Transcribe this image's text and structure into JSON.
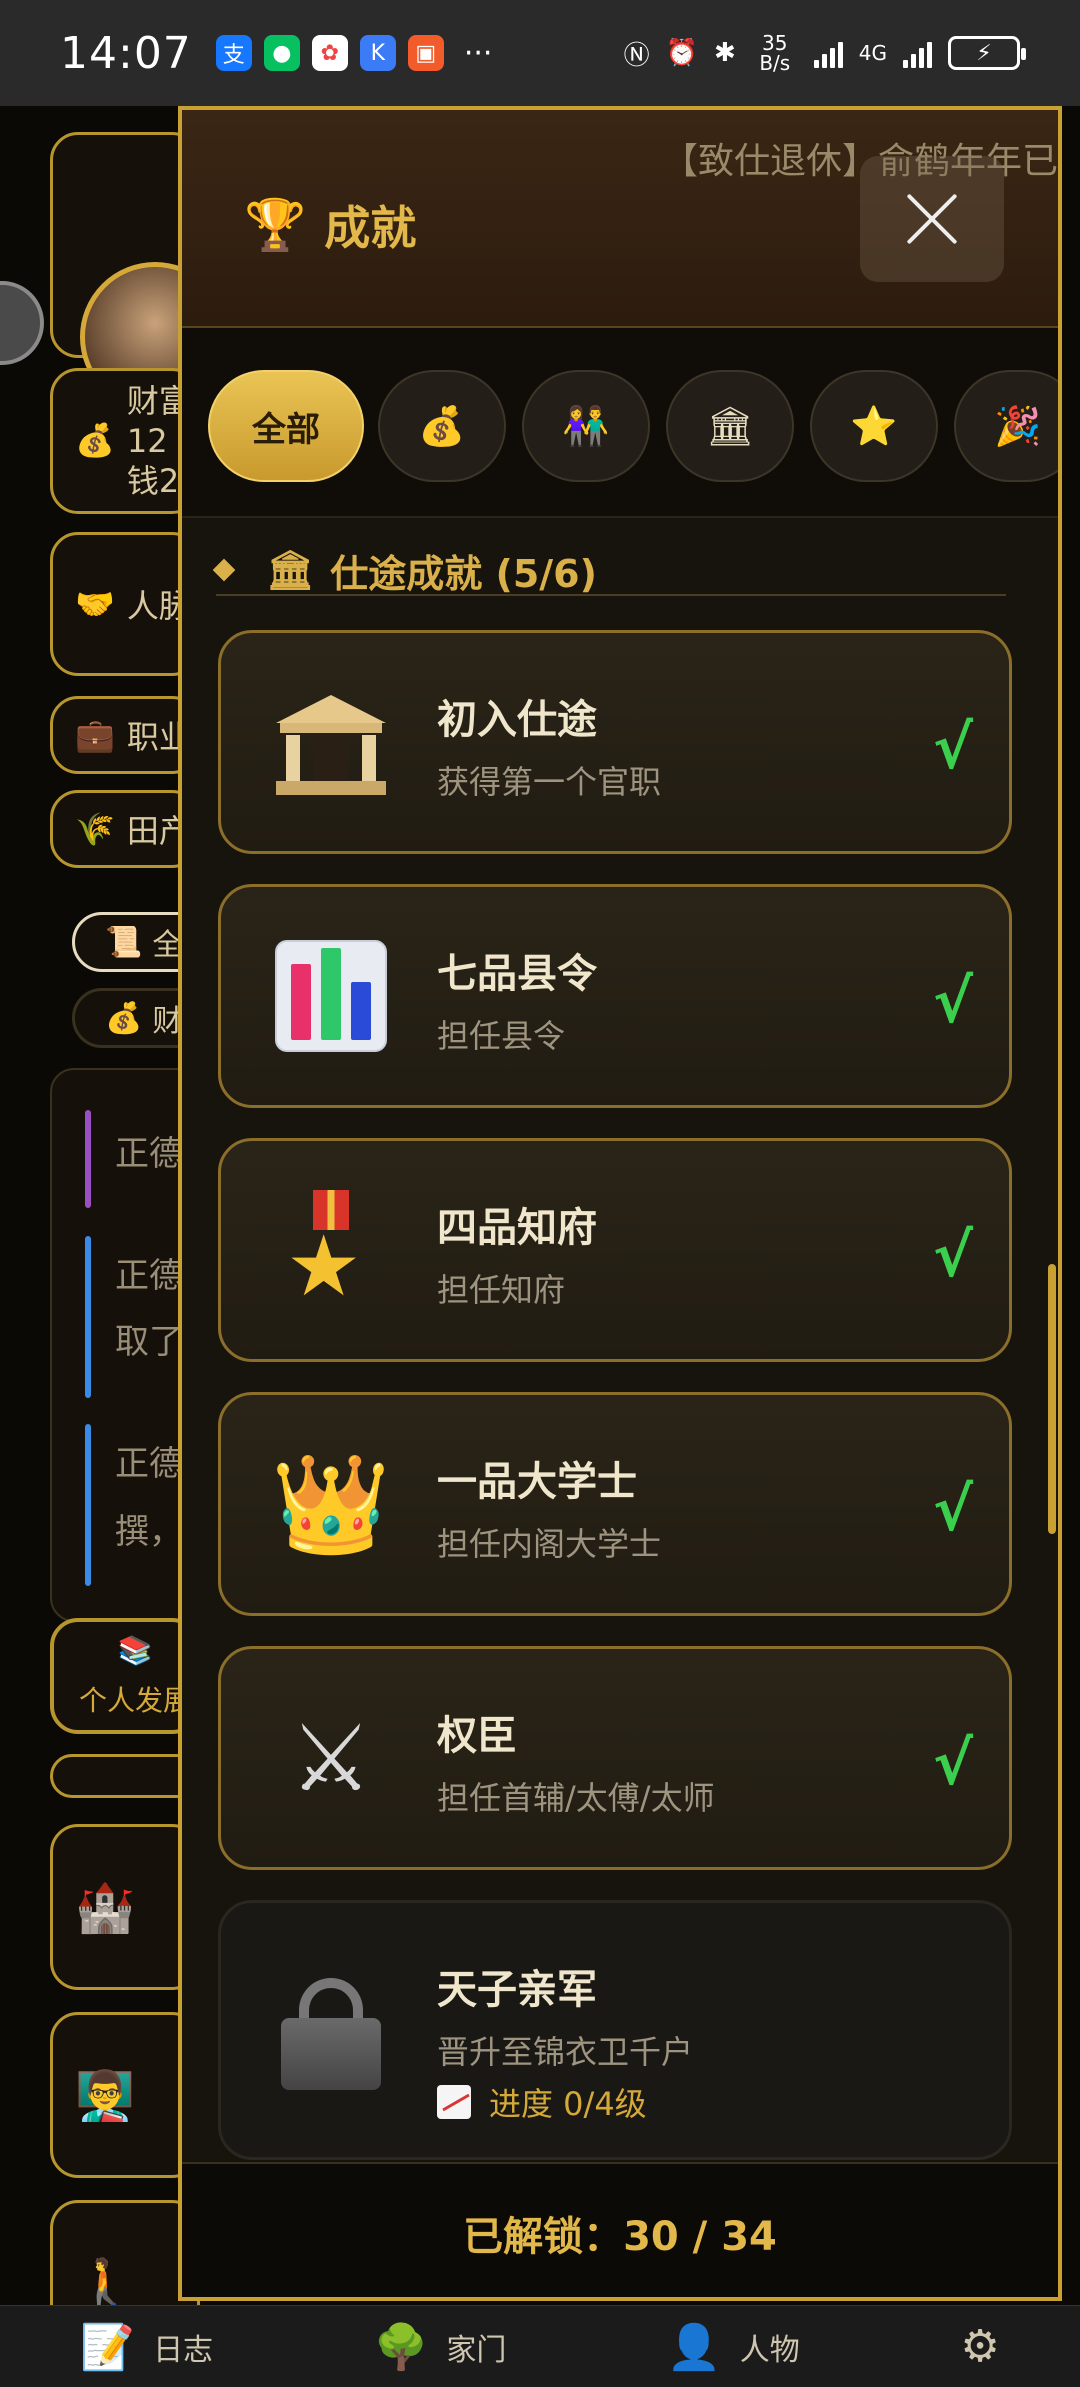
{
  "status_bar": {
    "time": "14:07",
    "dots": "···",
    "net_speed": "35 B/s",
    "net_type": "4G"
  },
  "background": {
    "wealth_label": "财富",
    "wealth_value": "12",
    "money_label": "钱2",
    "relations_label": "人脉",
    "career_label": "职业",
    "farm_label": "田产",
    "filter_all": "全",
    "filter_wealth": "财",
    "log_1": "正德",
    "log_2a": "正德",
    "log_2b": "取了",
    "log_3a": "正德",
    "log_3b": "撰，",
    "personal_dev": "个人发展",
    "colors": {
      "purple": "#9a4fc2",
      "blue": "#3a8ae8"
    }
  },
  "bottom_nav": {
    "items": [
      {
        "label": "日志",
        "icon": "memo-icon"
      },
      {
        "label": "家门",
        "icon": "tree-icon"
      },
      {
        "label": "人物",
        "icon": "person-icon"
      },
      {
        "label": "",
        "icon": "gear-icon"
      }
    ]
  },
  "modal": {
    "marquee": "【致仕退休】俞鹤年年已七",
    "title": "成就",
    "filters": [
      {
        "label": "全部",
        "active": true
      },
      {
        "label": "💰",
        "active": false
      },
      {
        "label": "👫",
        "active": false
      },
      {
        "label": "🏛",
        "active": false
      },
      {
        "label": "⭐",
        "active": false
      },
      {
        "label": "🎉",
        "active": false
      }
    ],
    "section_title": "仕途成就 (5/6)",
    "achievements": [
      {
        "title": "初入仕途",
        "desc": "获得第一个官职",
        "done": true,
        "icon": "temple-icon"
      },
      {
        "title": "七品县令",
        "desc": "担任县令",
        "done": true,
        "icon": "bar-chart-icon"
      },
      {
        "title": "四品知府",
        "desc": "担任知府",
        "done": true,
        "icon": "medal-icon"
      },
      {
        "title": "一品大学士",
        "desc": "担任内阁大学士",
        "done": true,
        "icon": "crown-icon"
      },
      {
        "title": "权臣",
        "desc": "担任首辅/太傅/太师",
        "done": true,
        "icon": "crossed-swords-icon"
      },
      {
        "title": "天子亲军",
        "desc": "晋升至锦衣卫千户",
        "done": false,
        "icon": "lock-icon",
        "progress": "进度 0/4级"
      }
    ],
    "check_mark": "√",
    "footer": "已解锁：30 / 34"
  }
}
